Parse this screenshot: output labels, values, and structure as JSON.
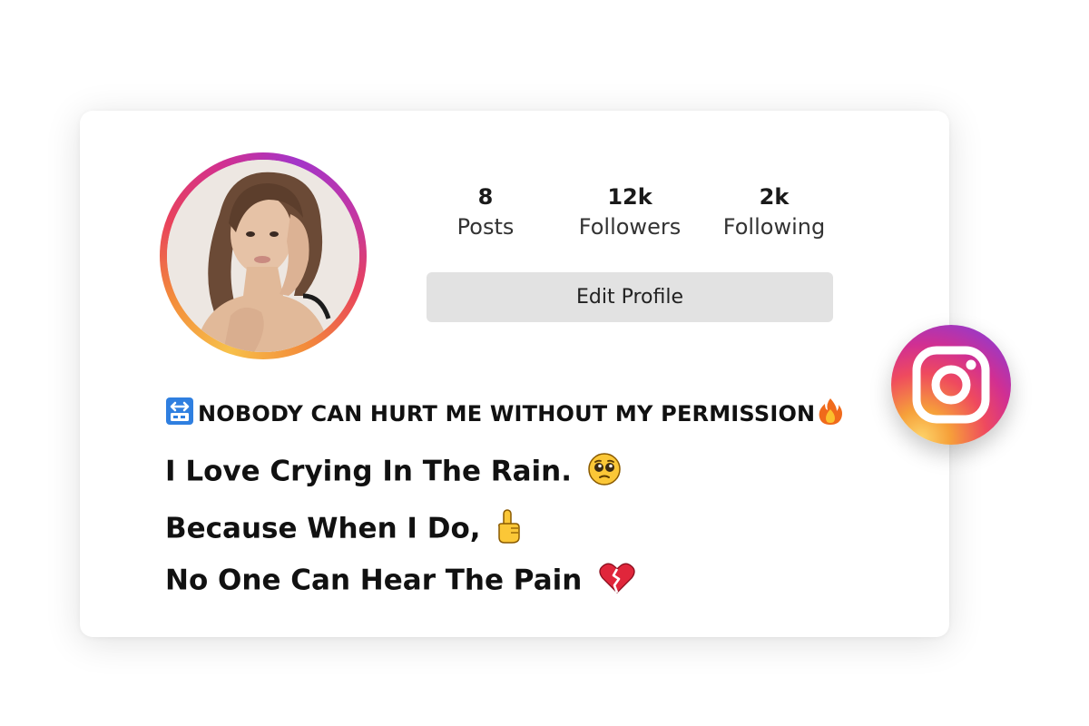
{
  "profile": {
    "stats": [
      {
        "value": "8",
        "label": "Posts"
      },
      {
        "value": "12k",
        "label": "Followers"
      },
      {
        "value": "2k",
        "label": "Following"
      }
    ],
    "edit_button_label": "Edit Profile"
  },
  "bio": {
    "line1": "NOBODY CAN HURT ME WITHOUT MY PERMISSION",
    "line2": "I Love Crying In The Rain.",
    "line3": "Because When I Do,",
    "line4": "No One Can Hear The Pain"
  },
  "icons": {
    "badge": "instagram-logo-icon",
    "line1_start": "on-arrow-emoji-icon",
    "line1_end": "fire-emoji-icon",
    "line2_end": "pleading-face-emoji-icon",
    "line3_end": "pointing-up-emoji-icon",
    "line4_end": "broken-heart-emoji-icon"
  },
  "colors": {
    "ring_gradient": [
      "#f7c04a",
      "#e8425c",
      "#a335c9"
    ],
    "button_bg": "#e2e2e2",
    "text": "#111111"
  }
}
